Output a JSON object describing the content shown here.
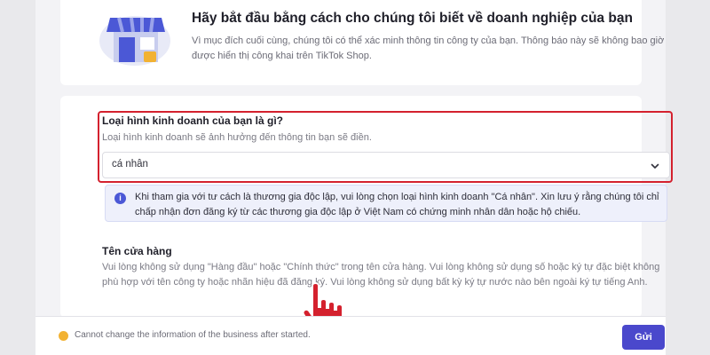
{
  "intro": {
    "title": "Hãy bắt đầu bằng cách cho chúng tôi biết về doanh nghiệp của bạn",
    "description": "Vì mục đích cuối cùng, chúng tôi có thể xác minh thông tin công ty của bạn. Thông báo này sẽ không bao giờ được hiển thị công khai trên TikTok Shop.",
    "illustration_icon": "shop-storefront-icon"
  },
  "business_type": {
    "question": "Loại hình kinh doanh của bạn là gì?",
    "hint": "Loại hình kinh doanh sẽ ảnh hưởng đến thông tin bạn sẽ điền.",
    "selected_value": "cá nhân",
    "highlight_color": "#d4212e"
  },
  "info_notice": {
    "icon": "info-icon",
    "icon_glyph": "i",
    "text": "Khi tham gia với tư cách là thương gia độc lập, vui lòng chọn loại hình kinh doanh \"Cá nhân\". Xin lưu ý rằng chúng tôi chỉ chấp nhận đơn đăng ký từ các thương gia độc lập ở Việt Nam có chứng minh nhân dân hoặc hộ chiếu."
  },
  "store_name": {
    "label": "Tên cửa hàng",
    "description": "Vui lòng không sử dụng \"Hàng đầu\" hoặc \"Chính thức\" trong tên cửa hàng. Vui lòng không sử dụng số hoặc ký tự đặc biệt không phù hợp với tên công ty hoặc nhãn hiệu đã đăng ký. Vui lòng không sử dụng bất kỳ ký tự nước nào bên ngoài ký tự tiếng Anh."
  },
  "footer": {
    "warning_icon": "warning-dot-icon",
    "warning_text": "Cannot change the information of the business after started.",
    "submit_label": "Gửi"
  },
  "colors": {
    "accent": "#4a48cc",
    "pointer": "#d4212e",
    "warning": "#f2b233"
  }
}
